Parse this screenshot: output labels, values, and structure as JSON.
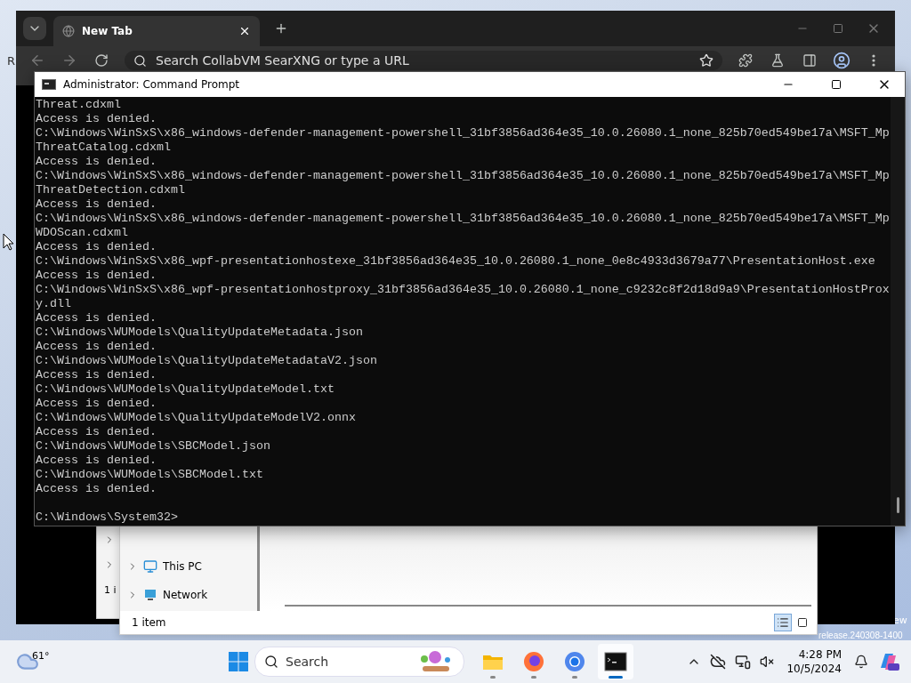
{
  "desktop": {
    "icon_label": "R",
    "watermark": [
      "ew",
      "release.240308-1400"
    ]
  },
  "browser": {
    "tab": {
      "title": "New Tab"
    },
    "omnibox": {
      "placeholder": "Search CollabVM SearXNG or type a URL"
    }
  },
  "explorer_back": {
    "status": "1 i"
  },
  "explorer": {
    "nav_items": [
      {
        "label": "This PC",
        "kind": "pc"
      },
      {
        "label": "Network",
        "kind": "network"
      }
    ],
    "status": "1 item",
    "views": [
      {
        "kind": "details",
        "selected": true
      },
      {
        "kind": "tiles",
        "selected": false
      }
    ]
  },
  "cmd": {
    "title": "Administrator: Command Prompt",
    "lines": [
      "Threat.cdxml",
      "Access is denied.",
      "C:\\Windows\\WinSxS\\x86_windows-defender-management-powershell_31bf3856ad364e35_10.0.26080.1_none_825b70ed549be17a\\MSFT_Mp",
      "ThreatCatalog.cdxml",
      "Access is denied.",
      "C:\\Windows\\WinSxS\\x86_windows-defender-management-powershell_31bf3856ad364e35_10.0.26080.1_none_825b70ed549be17a\\MSFT_Mp",
      "ThreatDetection.cdxml",
      "Access is denied.",
      "C:\\Windows\\WinSxS\\x86_windows-defender-management-powershell_31bf3856ad364e35_10.0.26080.1_none_825b70ed549be17a\\MSFT_Mp",
      "WDOScan.cdxml",
      "Access is denied.",
      "C:\\Windows\\WinSxS\\x86_wpf-presentationhostexe_31bf3856ad364e35_10.0.26080.1_none_0e8c4933d3679a77\\PresentationHost.exe",
      "Access is denied.",
      "C:\\Windows\\WinSxS\\x86_wpf-presentationhostproxy_31bf3856ad364e35_10.0.26080.1_none_c9232c8f2d18d9a9\\PresentationHostProx",
      "y.dll",
      "Access is denied.",
      "C:\\Windows\\WUModels\\QualityUpdateMetadata.json",
      "Access is denied.",
      "C:\\Windows\\WUModels\\QualityUpdateMetadataV2.json",
      "Access is denied.",
      "C:\\Windows\\WUModels\\QualityUpdateModel.txt",
      "Access is denied.",
      "C:\\Windows\\WUModels\\QualityUpdateModelV2.onnx",
      "Access is denied.",
      "C:\\Windows\\WUModels\\SBCModel.json",
      "Access is denied.",
      "C:\\Windows\\WUModels\\SBCModel.txt",
      "Access is denied."
    ],
    "prompt": "C:\\Windows\\System32>"
  },
  "taskbar": {
    "weather": "61°",
    "search": {
      "placeholder": "Search"
    },
    "apps": [
      {
        "kind": "explorer",
        "active": false
      },
      {
        "kind": "firefox",
        "active": false
      },
      {
        "kind": "chrome",
        "active": false
      },
      {
        "kind": "terminal",
        "active": true
      }
    ],
    "time": "4:28 PM",
    "date": "10/5/2024"
  }
}
